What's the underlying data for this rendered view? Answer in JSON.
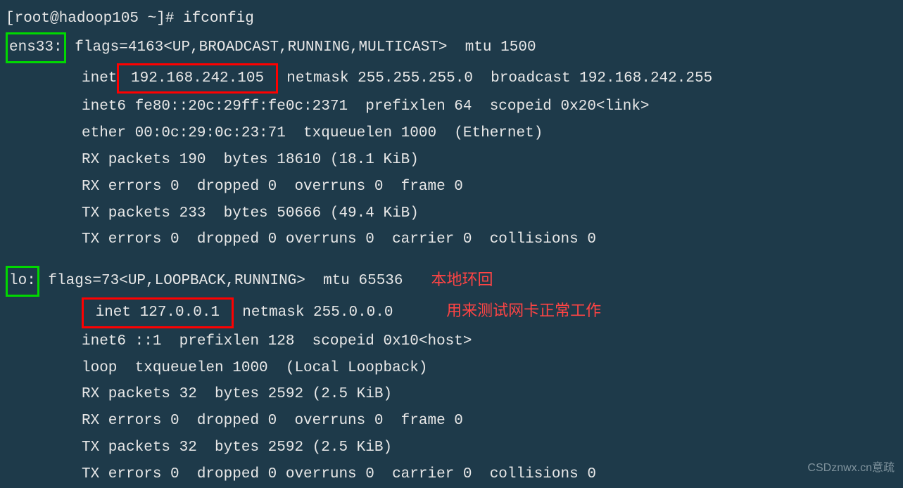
{
  "prompt": "[root@hadoop105 ~]# ",
  "command": "ifconfig",
  "iface1": {
    "name": "ens33:",
    "flags": "flags=4163<UP,BROADCAST,RUNNING,MULTICAST>  mtu 1500",
    "inet_label": "inet",
    "ip": " 192.168.242.105 ",
    "inet_rest": " netmask 255.255.255.0  broadcast 192.168.242.255",
    "inet6": "inet6 fe80::20c:29ff:fe0c:2371  prefixlen 64  scopeid 0x20<link>",
    "ether": "ether 00:0c:29:0c:23:71  txqueuelen 1000  (Ethernet)",
    "rxp": "RX packets 190  bytes 18610 (18.1 KiB)",
    "rxe": "RX errors 0  dropped 0  overruns 0  frame 0",
    "txp": "TX packets 233  bytes 50666 (49.4 KiB)",
    "txe": "TX errors 0  dropped 0 overruns 0  carrier 0  collisions 0"
  },
  "iface2": {
    "name": "lo:",
    "flags": " flags=73<UP,LOOPBACK,RUNNING>  mtu 65536",
    "inet_full": " inet 127.0.0.1 ",
    "inet_rest": " netmask 255.0.0.0",
    "inet6": "inet6 ::1  prefixlen 128  scopeid 0x10<host>",
    "loop": "loop  txqueuelen 1000  (Local Loopback)",
    "rxp": "RX packets 32  bytes 2592 (2.5 KiB)",
    "rxe": "RX errors 0  dropped 0  overruns 0  frame 0",
    "txp": "TX packets 32  bytes 2592 (2.5 KiB)",
    "txe": "TX errors 0  dropped 0 overruns 0  carrier 0  collisions 0"
  },
  "annot": {
    "line1": "本地环回",
    "line2": "用来测试网卡正常工作"
  },
  "watermark": "CSDznwx.cn意疏"
}
